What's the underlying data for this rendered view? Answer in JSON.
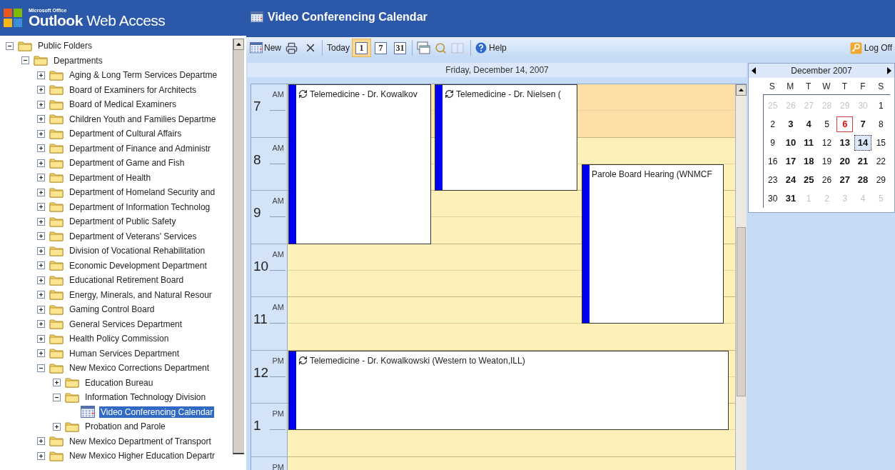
{
  "brand": {
    "small": "Microsoft Office",
    "name": "**Outlook** Web Access"
  },
  "folders": [
    {
      "name": "Public Folders",
      "kind": "folder",
      "expanded": true,
      "selected": false,
      "children": [
        {
          "name": "Departments",
          "kind": "folder",
          "expanded": true,
          "selected": false,
          "children": [
            {
              "name": "Aging & Long Term Services Departme",
              "kind": "folder",
              "expanded": false,
              "selected": false
            },
            {
              "name": "Board of Examiners for Architects",
              "kind": "folder",
              "expanded": false,
              "selected": false
            },
            {
              "name": "Board of Medical Examiners",
              "kind": "folder",
              "expanded": false,
              "selected": false
            },
            {
              "name": "Children Youth and Families Departme",
              "kind": "folder",
              "expanded": false,
              "selected": false
            },
            {
              "name": "Department of Cultural Affairs",
              "kind": "folder",
              "expanded": false,
              "selected": false
            },
            {
              "name": "Department of Finance and Administr",
              "kind": "folder",
              "expanded": false,
              "selected": false
            },
            {
              "name": "Department of Game and Fish",
              "kind": "folder",
              "expanded": false,
              "selected": false
            },
            {
              "name": "Department of Health",
              "kind": "folder",
              "expanded": false,
              "selected": false
            },
            {
              "name": "Department of Homeland Security and",
              "kind": "folder",
              "expanded": false,
              "selected": false
            },
            {
              "name": "Department of Information Technolog",
              "kind": "folder",
              "expanded": false,
              "selected": false
            },
            {
              "name": "Department of Public Safety",
              "kind": "folder",
              "expanded": false,
              "selected": false
            },
            {
              "name": "Department of Veterans' Services",
              "kind": "folder",
              "expanded": false,
              "selected": false
            },
            {
              "name": "Division of Vocational Rehabilitation",
              "kind": "folder",
              "expanded": false,
              "selected": false
            },
            {
              "name": "Economic Development Department",
              "kind": "folder",
              "expanded": false,
              "selected": false
            },
            {
              "name": "Educational Retirement Board",
              "kind": "folder",
              "expanded": false,
              "selected": false
            },
            {
              "name": "Energy, Minerals, and Natural Resour",
              "kind": "folder",
              "expanded": false,
              "selected": false
            },
            {
              "name": "Gaming Control Board",
              "kind": "folder",
              "expanded": false,
              "selected": false
            },
            {
              "name": "General Services Department",
              "kind": "folder",
              "expanded": false,
              "selected": false
            },
            {
              "name": "Health Policy Commission",
              "kind": "folder",
              "expanded": false,
              "selected": false
            },
            {
              "name": "Human Services Department",
              "kind": "folder",
              "expanded": false,
              "selected": false
            },
            {
              "name": "New Mexico Corrections Department",
              "kind": "folder",
              "expanded": true,
              "selected": false,
              "children": [
                {
                  "name": "Education Bureau",
                  "kind": "folder",
                  "expanded": false,
                  "selected": false
                },
                {
                  "name": "Information Technology Division",
                  "kind": "folder",
                  "expanded": true,
                  "selected": false,
                  "children": [
                    {
                      "name": "Video Conferencing Calendar",
                      "kind": "calendar",
                      "selected": true
                    }
                  ]
                },
                {
                  "name": "Probation and Parole",
                  "kind": "folder",
                  "expanded": false,
                  "selected": false
                }
              ]
            },
            {
              "name": "New Mexico Department of Transport",
              "kind": "folder",
              "expanded": false,
              "selected": false
            },
            {
              "name": "New Mexico Higher Education Departr",
              "kind": "folder",
              "expanded": false,
              "selected": false
            }
          ]
        }
      ]
    }
  ],
  "title": "Video Conferencing Calendar",
  "toolbar": {
    "new_label": "New",
    "today_label": "Today",
    "views": [
      {
        "label": "1",
        "selected": true
      },
      {
        "label": "7",
        "selected": false
      },
      {
        "label": "31",
        "selected": false
      }
    ],
    "address_book_disabled": true,
    "help_label": "Help",
    "logoff_label": "Log Off"
  },
  "day_header": "Friday, December 14, 2007",
  "hours": [
    {
      "hour": "7",
      "ampm": "AM",
      "working": false
    },
    {
      "hour": "8",
      "ampm": "AM",
      "working": true
    },
    {
      "hour": "9",
      "ampm": "AM",
      "working": true
    },
    {
      "hour": "10",
      "ampm": "AM",
      "working": true
    },
    {
      "hour": "11",
      "ampm": "AM",
      "working": true
    },
    {
      "hour": "12",
      "ampm": "PM",
      "working": true
    },
    {
      "hour": "1",
      "ampm": "PM",
      "working": true
    },
    {
      "ampm": "PM",
      "working": true
    }
  ],
  "events": [
    {
      "title": "Telemedicine - Dr. Kowalkov",
      "recurring": true
    },
    {
      "title": "Telemedicine - Dr. Nielsen (",
      "recurring": true
    },
    {
      "title": "Parole Board Hearing (WNMCF",
      "recurring": false
    },
    {
      "title": "Telemedicine - Dr. Kowalkowski (Western to Weaton,ILL)",
      "recurring": true
    }
  ],
  "mini_calendar": {
    "month": "December 2007",
    "weekdays": [
      "S",
      "M",
      "T",
      "W",
      "T",
      "F",
      "S"
    ],
    "weeks": [
      [
        {
          "day": "25",
          "other_month": true,
          "busy": false,
          "today": false,
          "selected": false
        },
        {
          "day": "26",
          "other_month": true,
          "busy": false,
          "today": false,
          "selected": false
        },
        {
          "day": "27",
          "other_month": true,
          "busy": false,
          "today": false,
          "selected": false
        },
        {
          "day": "28",
          "other_month": true,
          "busy": false,
          "today": false,
          "selected": false
        },
        {
          "day": "29",
          "other_month": true,
          "busy": false,
          "today": false,
          "selected": false
        },
        {
          "day": "30",
          "other_month": true,
          "busy": false,
          "today": false,
          "selected": false
        },
        {
          "day": "1",
          "other_month": false,
          "busy": false,
          "today": false,
          "selected": false
        }
      ],
      [
        {
          "day": "2",
          "other_month": false,
          "busy": false,
          "today": false,
          "selected": false
        },
        {
          "day": "3",
          "other_month": false,
          "busy": true,
          "today": false,
          "selected": false
        },
        {
          "day": "4",
          "other_month": false,
          "busy": true,
          "today": false,
          "selected": false
        },
        {
          "day": "5",
          "other_month": false,
          "busy": false,
          "today": false,
          "selected": false
        },
        {
          "day": "6",
          "other_month": false,
          "busy": true,
          "today": true,
          "selected": false
        },
        {
          "day": "7",
          "other_month": false,
          "busy": true,
          "today": false,
          "selected": false
        },
        {
          "day": "8",
          "other_month": false,
          "busy": false,
          "today": false,
          "selected": false
        }
      ],
      [
        {
          "day": "9",
          "other_month": false,
          "busy": false,
          "today": false,
          "selected": false
        },
        {
          "day": "10",
          "other_month": false,
          "busy": true,
          "today": false,
          "selected": false
        },
        {
          "day": "11",
          "other_month": false,
          "busy": true,
          "today": false,
          "selected": false
        },
        {
          "day": "12",
          "other_month": false,
          "busy": false,
          "today": false,
          "selected": false
        },
        {
          "day": "13",
          "other_month": false,
          "busy": true,
          "today": false,
          "selected": false
        },
        {
          "day": "14",
          "other_month": false,
          "busy": true,
          "today": false,
          "selected": true
        },
        {
          "day": "15",
          "other_month": false,
          "busy": false,
          "today": false,
          "selected": false
        }
      ],
      [
        {
          "day": "16",
          "other_month": false,
          "busy": false,
          "today": false,
          "selected": false
        },
        {
          "day": "17",
          "other_month": false,
          "busy": true,
          "today": false,
          "selected": false
        },
        {
          "day": "18",
          "other_month": false,
          "busy": true,
          "today": false,
          "selected": false
        },
        {
          "day": "19",
          "other_month": false,
          "busy": false,
          "today": false,
          "selected": false
        },
        {
          "day": "20",
          "other_month": false,
          "busy": true,
          "today": false,
          "selected": false
        },
        {
          "day": "21",
          "other_month": false,
          "busy": true,
          "today": false,
          "selected": false
        },
        {
          "day": "22",
          "other_month": false,
          "busy": false,
          "today": false,
          "selected": false
        }
      ],
      [
        {
          "day": "23",
          "other_month": false,
          "busy": false,
          "today": false,
          "selected": false
        },
        {
          "day": "24",
          "other_month": false,
          "busy": true,
          "today": false,
          "selected": false
        },
        {
          "day": "25",
          "other_month": false,
          "busy": true,
          "today": false,
          "selected": false
        },
        {
          "day": "26",
          "other_month": false,
          "busy": false,
          "today": false,
          "selected": false
        },
        {
          "day": "27",
          "other_month": false,
          "busy": true,
          "today": false,
          "selected": false
        },
        {
          "day": "28",
          "other_month": false,
          "busy": true,
          "today": false,
          "selected": false
        },
        {
          "day": "29",
          "other_month": false,
          "busy": false,
          "today": false,
          "selected": false
        }
      ],
      [
        {
          "day": "30",
          "other_month": false,
          "busy": false,
          "today": false,
          "selected": false
        },
        {
          "day": "31",
          "other_month": false,
          "busy": true,
          "today": false,
          "selected": false
        },
        {
          "day": "1",
          "other_month": true,
          "busy": false,
          "today": false,
          "selected": false
        },
        {
          "day": "2",
          "other_month": true,
          "busy": false,
          "today": false,
          "selected": false
        },
        {
          "day": "3",
          "other_month": true,
          "busy": false,
          "today": false,
          "selected": false
        },
        {
          "day": "4",
          "other_month": true,
          "busy": false,
          "today": false,
          "selected": false
        },
        {
          "day": "5",
          "other_month": true,
          "busy": false,
          "today": false,
          "selected": false
        }
      ]
    ]
  }
}
